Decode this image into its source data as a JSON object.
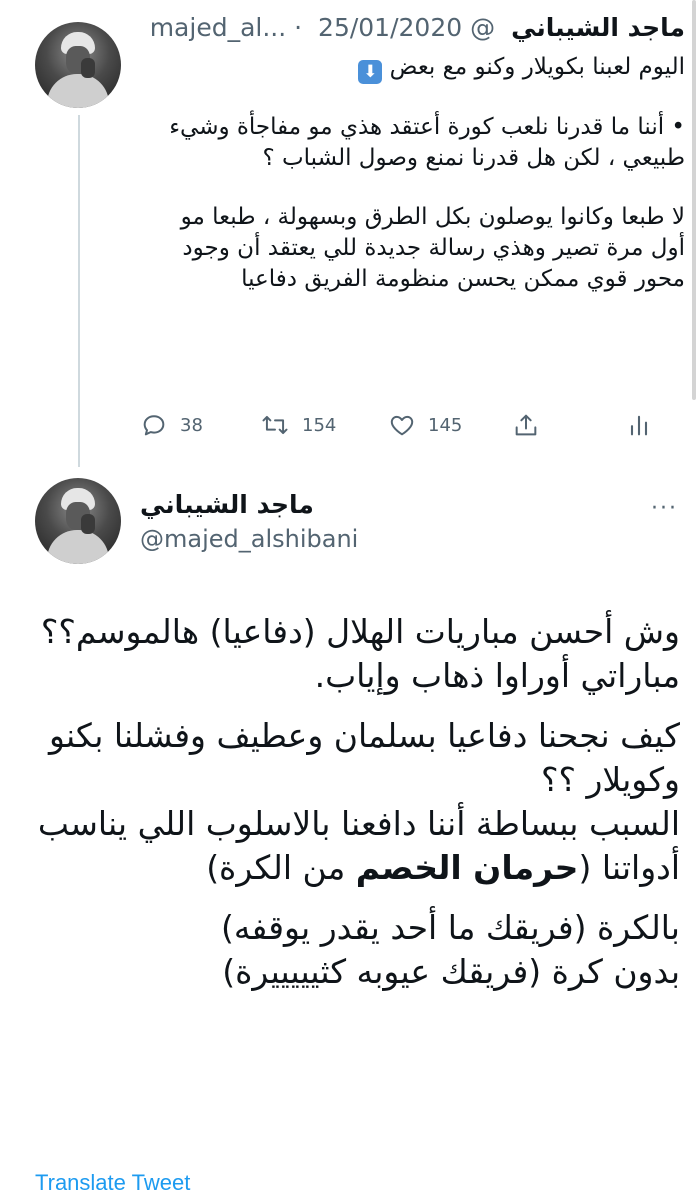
{
  "tweet1": {
    "name": "ماجد الشيباني",
    "handle": "@majed_al...",
    "separator": "·",
    "date": "25/01/2020",
    "line1": "اليوم لعبنا بكويلار وكنو مع بعض",
    "emoji": "⬇",
    "para1": "• أننا ما قدرنا نلعب كورة أعتقد هذي مو مفاجأة وشيء طبيعي ، لكن هل قدرنا نمنع وصول الشباب ؟",
    "para2": "لا طبعا وكانوا يوصلون بكل الطرق وبسهولة ، طبعا مو أول مرة تصير وهذي رسالة جديدة للي يعتقد أن وجود محور قوي ممكن يحسن منظومة الفريق دفاعيا",
    "actions": {
      "replies": "38",
      "retweets": "154",
      "likes": "145"
    }
  },
  "tweet2": {
    "name": "ماجد الشيباني",
    "handle": "@majed_alshibani",
    "more": "···",
    "line1": "وش أحسن مباريات الهلال (دفاعيا) هالموسم؟؟",
    "line2": "مباراتي أوراوا ذهاب وإياب.",
    "line3": "كيف نجحنا دفاعيا بسلمان وعطيف وفشلنا بكنو وكويلار ؟؟",
    "line4_start": "السبب ببساطة أننا دافعنا بالاسلوب اللي يناسب أدواتنا (",
    "line4_bold": "حرمان الخصم",
    "line4_end": " من الكرة)",
    "line5": "بالكرة (فريقك ما أحد يقدر يوقفه)",
    "line6": "بدون كرة (فريقك عيوبه كثيييييرة)",
    "translate": "Translate Tweet"
  },
  "colors": {
    "text": "#0f1419",
    "secondary": "#536471",
    "link": "#1d9bf0",
    "thread_line": "#cfd9de"
  }
}
